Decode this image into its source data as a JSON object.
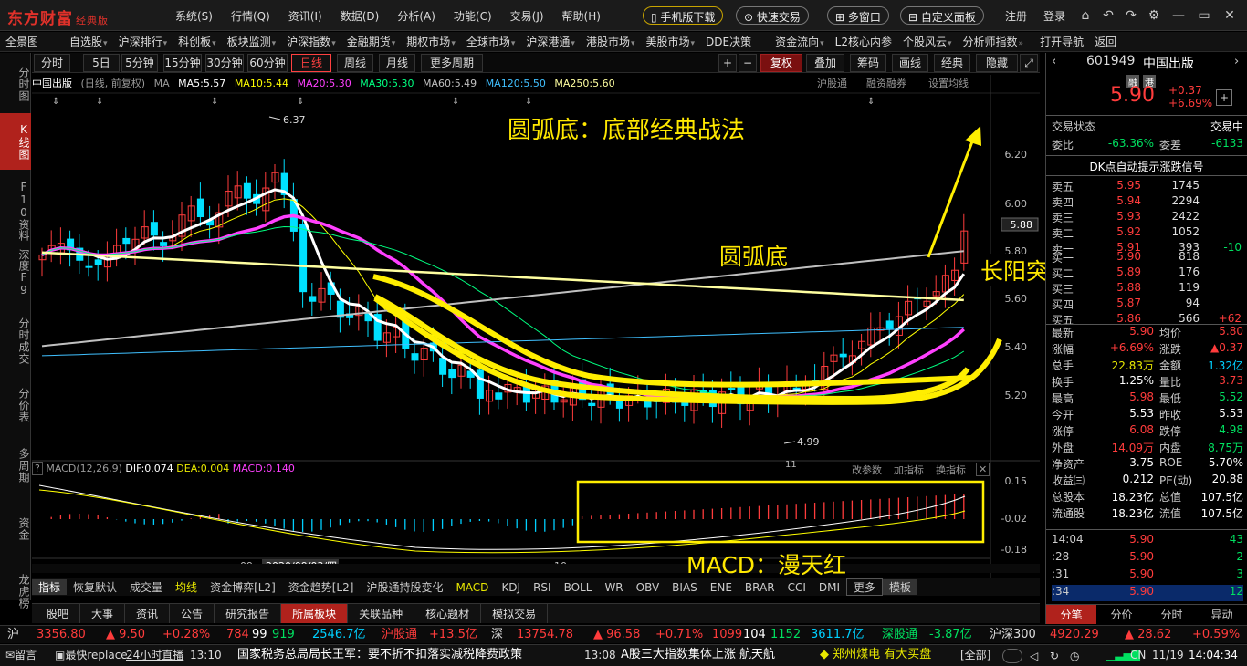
{
  "app": {
    "logo": "东方财富",
    "edition": "经典版"
  },
  "top_menu": [
    "系统(S)",
    "行情(Q)",
    "资讯(I)",
    "数据(D)",
    "分析(A)",
    "功能(C)",
    "交易(J)",
    "帮助(H)"
  ],
  "top_buttons": {
    "mobile": "手机版下载",
    "quick_trade": "快速交易",
    "multi_window": "多窗口",
    "custom_panel": "自定义面板"
  },
  "top_right": {
    "register": "注册",
    "login": "登录"
  },
  "nav2": [
    "全景图",
    "自选股",
    "沪深排行",
    "科创板",
    "板块监测",
    "沪深指数",
    "金融期货",
    "期权市场",
    "全球市场",
    "沪深港通",
    "港股市场",
    "美股市场",
    "DDE决策",
    "资金流向",
    "L2核心内参",
    "个股风云",
    "分析师指数",
    "打开导航",
    "返回"
  ],
  "left_nav": [
    {
      "label": "分时图",
      "active": false
    },
    {
      "label": "K线图",
      "active": true
    },
    {
      "label": "F10资料",
      "active": false
    },
    {
      "label": "深度F9",
      "active": false
    },
    {
      "label": "分时成交",
      "active": false
    },
    {
      "label": "分价表",
      "active": false
    },
    {
      "label": "多周期",
      "active": false
    },
    {
      "label": "资金",
      "active": false
    },
    {
      "label": "龙虎榜",
      "active": false
    }
  ],
  "period_tabs": [
    "分时",
    "5日",
    "5分钟",
    "15分钟",
    "30分钟",
    "60分钟",
    "日线",
    "周线",
    "月线",
    "更多周期"
  ],
  "period_active": "日线",
  "tool_tabs": [
    "+",
    "−",
    "复权",
    "叠加",
    "筹码",
    "画线",
    "经典",
    "隐藏"
  ],
  "ma_header": {
    "stock": "中国出版",
    "mode": "(日线, 前复权)",
    "ma": "MA",
    "items": [
      {
        "label": "MA5:5.57",
        "color": "#ffffff"
      },
      {
        "label": "MA10:5.44",
        "color": "#ffff00"
      },
      {
        "label": "MA20:5.30",
        "color": "#ff40ff"
      },
      {
        "label": "MA30:5.30",
        "color": "#00ff80"
      },
      {
        "label": "MA60:5.49",
        "color": "#c0c0c0"
      },
      {
        "label": "MA120:5.50",
        "color": "#40c0ff"
      },
      {
        "label": "MA250:5.60",
        "color": "#ffffa0"
      }
    ],
    "links": [
      "沪股通",
      "融资融券",
      "设置均线"
    ]
  },
  "chart_labels": {
    "high": "6.37",
    "low": "4.99",
    "month1": "09",
    "date": "2020/09/03/四",
    "month2": "10",
    "month3": "11"
  },
  "price_axis": [
    "6.20",
    "6.00",
    "5.80",
    "5.60",
    "5.40",
    "5.20"
  ],
  "price_axis_current": "5.88",
  "macd_axis": [
    "0.15",
    "-0.02",
    "-0.18"
  ],
  "macd_header": {
    "title": "MACD(12,26,9)",
    "dif": "DIF:0.074",
    "dea": "DEA:0.004",
    "macd": "MACD:0.140",
    "links": [
      "改参数",
      "加指标",
      "换指标"
    ]
  },
  "annotations": {
    "title": "圆弧底：底部经典战法",
    "arc": "圆弧底",
    "breakout": "长阳突破",
    "macd": "MACD：漫天红"
  },
  "indicator_tabs": [
    "指标",
    "恢复默认",
    "成交量",
    "均线",
    "资金博弈[L2]",
    "资金趋势[L2]",
    "沪股通持股变化",
    "MACD",
    "KDJ",
    "RSI",
    "BOLL",
    "WR",
    "OBV",
    "BIAS",
    "ENE",
    "BRAR",
    "CCI",
    "DMI",
    "更多",
    "模板"
  ],
  "bottom_tabs": [
    "股吧",
    "大事",
    "资讯",
    "公告",
    "研究报告",
    "所属板块",
    "关联品种",
    "核心题材",
    "模拟交易"
  ],
  "bottom_active": "所属板块",
  "quote": {
    "code": "601949",
    "name": "中国出版",
    "tags": [
      "融",
      "港"
    ],
    "price": "5.90",
    "change": "+0.37",
    "pct": "+6.69%",
    "trade_status_label": "交易状态",
    "trade_status": "交易中",
    "ratio_label": "委比",
    "ratio": "-63.36%",
    "diff_label": "委差",
    "diff": "-6133",
    "signal": "DK点自动提示涨跌信号",
    "sells": [
      {
        "label": "卖五",
        "price": "5.95",
        "vol": "1745",
        "chg": ""
      },
      {
        "label": "卖四",
        "price": "5.94",
        "vol": "2294",
        "chg": ""
      },
      {
        "label": "卖三",
        "price": "5.93",
        "vol": "2422",
        "chg": ""
      },
      {
        "label": "卖二",
        "price": "5.92",
        "vol": "1052",
        "chg": ""
      },
      {
        "label": "卖一",
        "price": "5.91",
        "vol": "393",
        "chg": "-10"
      }
    ],
    "buys": [
      {
        "label": "买一",
        "price": "5.90",
        "vol": "818",
        "chg": ""
      },
      {
        "label": "买二",
        "price": "5.89",
        "vol": "176",
        "chg": ""
      },
      {
        "label": "买三",
        "price": "5.88",
        "vol": "119",
        "chg": ""
      },
      {
        "label": "买四",
        "price": "5.87",
        "vol": "94",
        "chg": ""
      },
      {
        "label": "买五",
        "price": "5.86",
        "vol": "566",
        "chg": "+62"
      }
    ],
    "stats": [
      {
        "l1": "最新",
        "v1": "5.90",
        "c1": "red",
        "l2": "均价",
        "v2": "5.80",
        "c2": "red"
      },
      {
        "l1": "涨幅",
        "v1": "+6.69%",
        "c1": "red",
        "l2": "涨跌",
        "v2": "▲0.37",
        "c2": "red"
      },
      {
        "l1": "总手",
        "v1": "22.83万",
        "c1": "yel",
        "l2": "金额",
        "v2": "1.32亿",
        "c2": "cy"
      },
      {
        "l1": "换手",
        "v1": "1.25%",
        "c1": "wh",
        "l2": "量比",
        "v2": "3.73",
        "c2": "red"
      },
      {
        "l1": "最高",
        "v1": "5.98",
        "c1": "red",
        "l2": "最低",
        "v2": "5.52",
        "c2": "grn"
      },
      {
        "l1": "今开",
        "v1": "5.53",
        "c1": "wh",
        "l2": "昨收",
        "v2": "5.53",
        "c2": "wh"
      },
      {
        "l1": "涨停",
        "v1": "6.08",
        "c1": "red",
        "l2": "跌停",
        "v2": "4.98",
        "c2": "grn"
      },
      {
        "l1": "外盘",
        "v1": "14.09万",
        "c1": "red",
        "l2": "内盘",
        "v2": "8.75万",
        "c2": "grn"
      },
      {
        "l1": "净资产",
        "v1": "3.75",
        "c1": "wh",
        "l2": "ROE",
        "v2": "5.70%",
        "c2": "wh"
      },
      {
        "l1": "收益㈢",
        "v1": "0.212",
        "c1": "wh",
        "l2": "PE(动)",
        "v2": "20.88",
        "c2": "wh"
      },
      {
        "l1": "总股本",
        "v1": "18.23亿",
        "c1": "wh",
        "l2": "总值",
        "v2": "107.5亿",
        "c2": "wh"
      },
      {
        "l1": "流通股",
        "v1": "18.23亿",
        "c1": "wh",
        "l2": "流值",
        "v2": "107.5亿",
        "c2": "wh"
      }
    ],
    "ticks": [
      {
        "t": "14:04",
        "p": "5.90",
        "v": "43",
        "vc": "grn"
      },
      {
        "t": ":28",
        "p": "5.90",
        "v": "2",
        "vc": "grn"
      },
      {
        "t": ":31",
        "p": "5.90",
        "v": "3",
        "vc": "grn"
      },
      {
        "t": ":34",
        "p": "5.90",
        "v": "12",
        "vc": "grn"
      }
    ],
    "tabs": [
      "分笔",
      "分价",
      "分时",
      "异动"
    ]
  },
  "ticker": {
    "sh": "沪",
    "sh_idx": "3356.80",
    "sh_chg": "▲ 9.50",
    "sh_pct": "+0.28%",
    "sh_up": "784",
    "sh_flat": "99",
    "sh_dn": "919",
    "sh_amt": "2546.7亿",
    "hgt": "沪股通",
    "hgt_val": "+13.5亿",
    "sz": "深",
    "sz_idx": "13754.78",
    "sz_chg": "▲ 96.58",
    "sz_pct": "+0.71%",
    "sz_up": "1099",
    "sz_flat": "104",
    "sz_dn": "1152",
    "sz_amt": "3611.7亿",
    "sgt": "深股通",
    "sgt_val": "-3.87亿",
    "hs300": "沪深300",
    "hs300_idx": "4920.29",
    "hs300_chg": "▲ 28.62",
    "hs300_pct": "+0.59%"
  },
  "status": {
    "msg": "留言",
    "quick": "最快replace",
    "live": "24小时直播",
    "time1": "13:10",
    "news1": "国家税务总局局长王军：要不折不扣落实减税降费政策",
    "time2": "13:08",
    "news2": "A股三大指数集体上涨  航天航",
    "stock_alert": "◆ 郑州煤电  有大买盘",
    "all": "[全部]",
    "cn": "CN",
    "date": "11/19",
    "clock": "14:04:34"
  }
}
